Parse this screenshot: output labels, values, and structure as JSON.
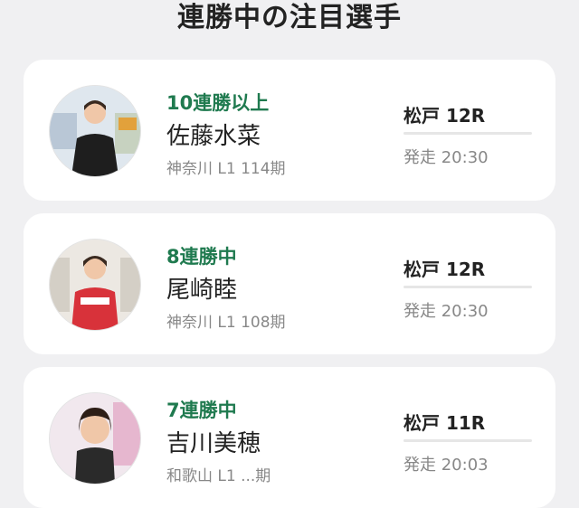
{
  "header": {
    "title": "連勝中の注目選手"
  },
  "racers": [
    {
      "streak": "10連勝以上",
      "name": "佐藤水菜",
      "info": "神奈川 L1 114期",
      "race": "松戸 12R",
      "start": "発走 20:30",
      "avatar": "racer-photo-icon"
    },
    {
      "streak": "8連勝中",
      "name": "尾崎睦",
      "info": "神奈川 L1 108期",
      "race": "松戸 12R",
      "start": "発走 20:30",
      "avatar": "racer-photo-icon"
    },
    {
      "streak": "7連勝中",
      "name": "吉川美穂",
      "info": "和歌山 L1 ...期",
      "race": "松戸 11R",
      "start": "発走 20:03",
      "avatar": "racer-photo-icon"
    }
  ],
  "colors": {
    "accent": "#1f7a4f",
    "background": "#f0f0f2",
    "card": "#ffffff"
  }
}
